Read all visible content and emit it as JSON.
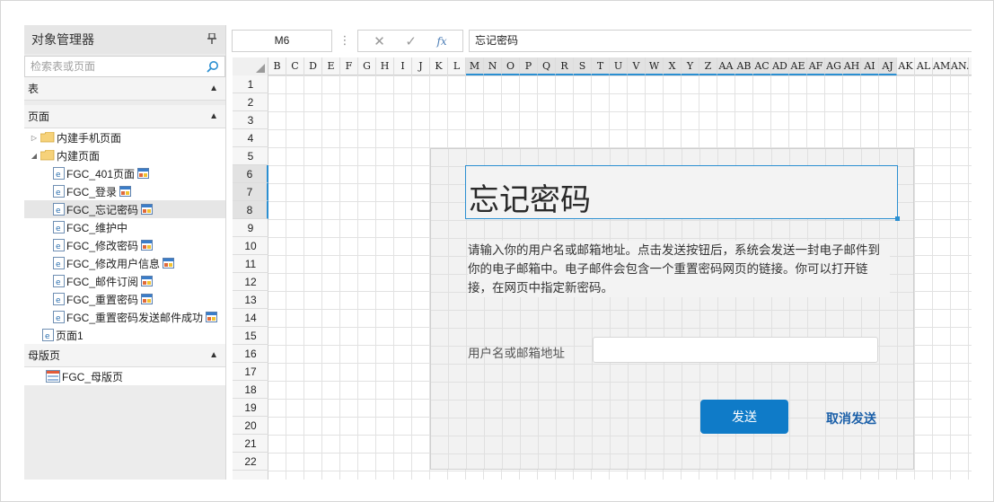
{
  "object_manager": {
    "title": "对象管理器",
    "search_placeholder": "检索表或页面",
    "sections": {
      "tables": "表",
      "pages": "页面",
      "masters": "母版页"
    },
    "pages_tree": [
      {
        "label": "内建手机页面",
        "type": "folder",
        "expanded": false
      },
      {
        "label": "内建页面",
        "type": "folder",
        "expanded": true
      },
      {
        "label": "FGC_401页面",
        "type": "page"
      },
      {
        "label": "FGC_登录",
        "type": "page"
      },
      {
        "label": "FGC_忘记密码",
        "type": "page",
        "selected": true
      },
      {
        "label": "FGC_维护中",
        "type": "page"
      },
      {
        "label": "FGC_修改密码",
        "type": "page"
      },
      {
        "label": "FGC_修改用户信息",
        "type": "page"
      },
      {
        "label": "FGC_邮件订阅",
        "type": "page"
      },
      {
        "label": "FGC_重置密码",
        "type": "page"
      },
      {
        "label": "FGC_重置密码发送邮件成功",
        "type": "page"
      },
      {
        "label": "页面1",
        "type": "page"
      }
    ],
    "master_tree": [
      {
        "label": "FGC_母版页",
        "type": "master"
      }
    ]
  },
  "formula_bar": {
    "cell_ref": "M6",
    "separator": "⋮",
    "cancel": "✕",
    "confirm": "✓",
    "fx": "fx",
    "value": "忘记密码"
  },
  "sheet": {
    "columns": [
      "B",
      "C",
      "D",
      "E",
      "F",
      "G",
      "H",
      "I",
      "J",
      "K",
      "L",
      "M",
      "N",
      "O",
      "P",
      "Q",
      "R",
      "S",
      "T",
      "U",
      "V",
      "W",
      "X",
      "Y",
      "Z",
      "AA",
      "AB",
      "AC",
      "AD",
      "AE",
      "AF",
      "AG",
      "AH",
      "AI",
      "AJ",
      "AK",
      "AL",
      "AM",
      "AN."
    ],
    "rows": [
      "1",
      "2",
      "3",
      "4",
      "5",
      "6",
      "7",
      "8",
      "9",
      "10",
      "11",
      "12",
      "13",
      "14",
      "15",
      "16",
      "17",
      "18",
      "19",
      "20",
      "21",
      "22"
    ]
  },
  "form": {
    "title": "忘记密码",
    "description": "请输入你的用户名或邮箱地址。点击发送按钮后，系统会发送一封电子邮件到你的电子邮箱中。电子邮件会包含一个重置密码网页的链接。你可以打开链接，在网页中指定新密码。",
    "field_label": "用户名或邮箱地址",
    "send_button": "发送",
    "cancel_link": "取消发送"
  },
  "colors": {
    "accent": "#2b8fd1",
    "button": "#0f7bc8",
    "link": "#1a5fa8"
  }
}
